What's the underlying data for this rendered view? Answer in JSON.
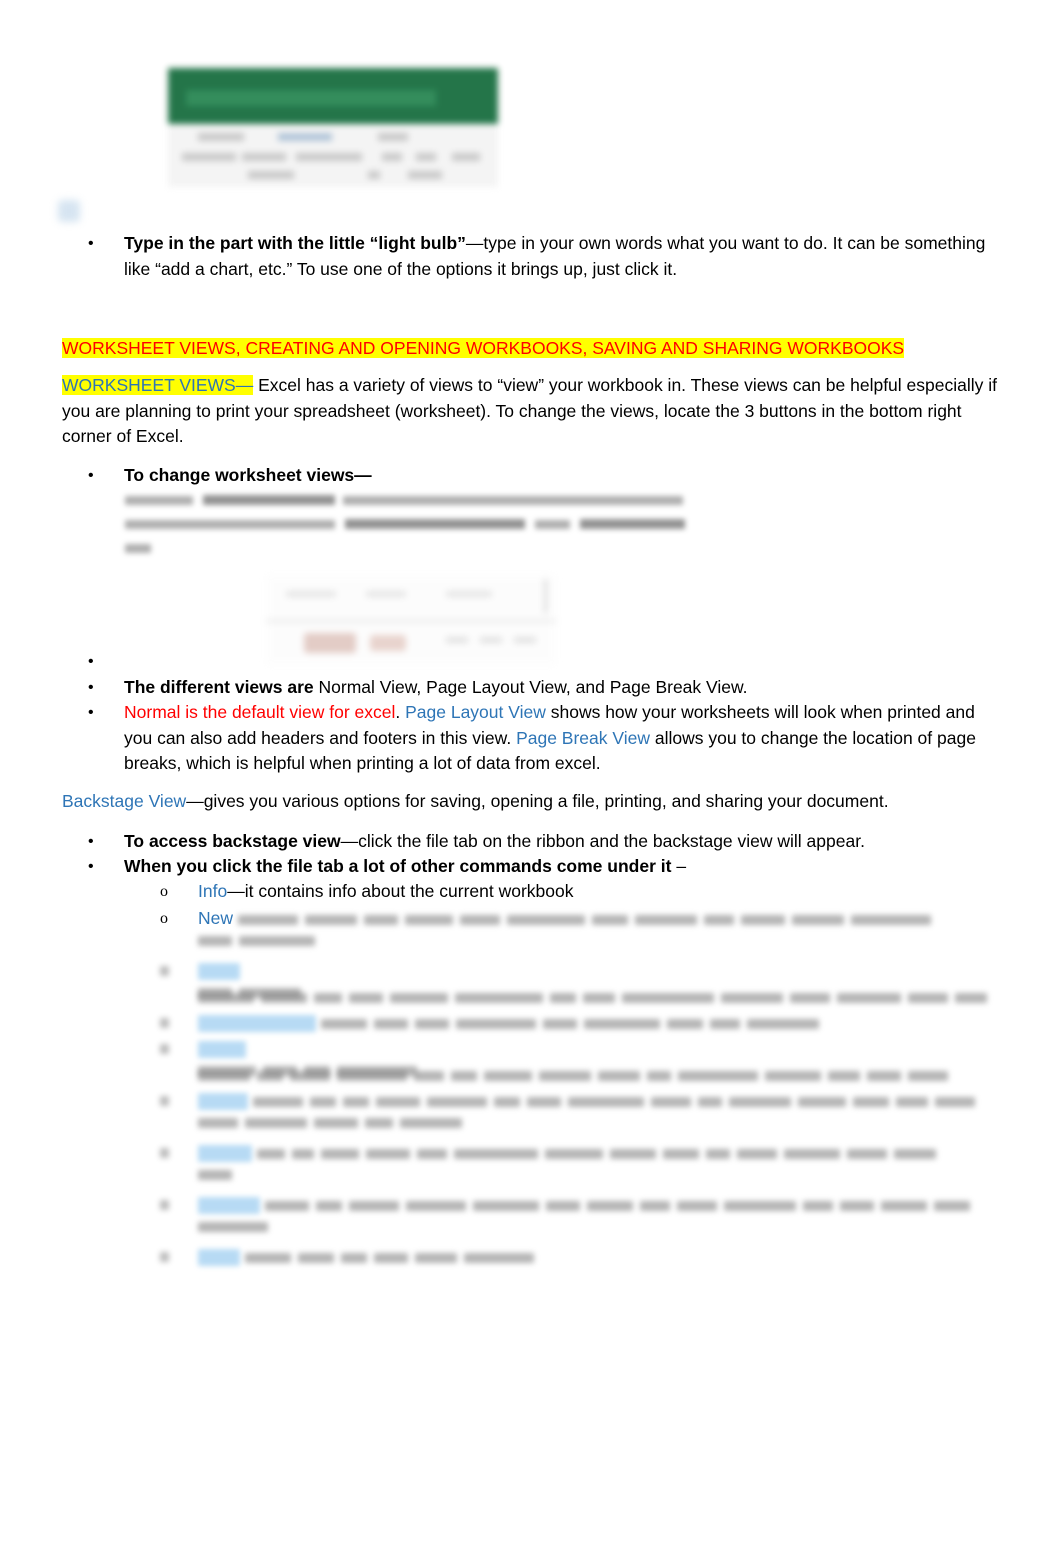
{
  "document": {
    "title": "Excel Notes - Worksheet Views and Backstage View",
    "colors": {
      "heading_red": "#ff0000",
      "link_blue": "#2e75b6",
      "highlight_yellow": "#ffff00",
      "body_black": "#000000",
      "excel_green": "#1d7144"
    }
  },
  "images": {
    "tell_me_screenshot": "excel-tell-me-lightbulb-screenshot",
    "worksheet_views_screenshot": "excel-worksheet-view-buttons-screenshot",
    "left_margin_artifact": "blurred-marker-artifact"
  },
  "intro_bullet": {
    "marker": "•",
    "bold_lead": "Type in the part with the little “light bulb”",
    "rest": "—type in your own words what you want to do.  It can be something like “add a chart, etc.” To use one of the options it brings up, just click it."
  },
  "section_heading": {
    "text": "WORKSHEET VIEWS, CREATING AND OPENING WORKBOOKS, SAVING AND SHARING WORKBOOKS"
  },
  "worksheet_views_para": {
    "label": "WORKSHEET VIEWS—",
    "body": " Excel has a variety of views to “view” your workbook in. These views can be helpful especially if you are planning to print your spreadsheet (worksheet).  To change the views, locate the 3 buttons in the bottom right corner of Excel."
  },
  "bullets": {
    "change_views": {
      "marker": "•",
      "bold_lead": "To change worksheet views—"
    },
    "empty": {
      "marker": "•",
      "text": ""
    },
    "different_views": {
      "marker": "•",
      "bold_lead": "The different views are",
      "rest": " Normal View, Page Layout View, and Page Break View."
    },
    "views_detail": {
      "marker": "•",
      "red_lead": "Normal is the default view for excel",
      "after_red": ".  ",
      "blue_1": "Page Layout View",
      "mid_1": " shows how your worksheets will look when printed and you can also add headers and footers in this view. ",
      "blue_2": " Page Break View",
      "mid_2": " allows you to change the location of page breaks, which is helpful when printing a lot of data from excel."
    }
  },
  "backstage_para": {
    "label": "Backstage View",
    "body": "—gives you various options for saving, opening a file, printing, and sharing your document."
  },
  "backstage_bullets": {
    "access": {
      "marker": "•",
      "bold_lead": "To access backstage view",
      "rest": "—click the file tab on the ribbon and the backstage view will appear."
    },
    "commands": {
      "marker": "•",
      "bold_lead": "When you click the file tab a lot of other commands come under it",
      "rest": " –"
    }
  },
  "sub_bullets": [
    {
      "marker": "o",
      "keyword": "Info",
      "description": "—it contains info about the current workbook",
      "blurred": false
    },
    {
      "marker": "o",
      "keyword": "New",
      "description": "",
      "blurred": true
    },
    {
      "marker": "o",
      "keyword": "",
      "description": "",
      "blurred": true
    },
    {
      "marker": "o",
      "keyword": "",
      "description": "",
      "blurred": true
    },
    {
      "marker": "o",
      "keyword": "",
      "description": "",
      "blurred": true
    },
    {
      "marker": "o",
      "keyword": "",
      "description": "",
      "blurred": true
    },
    {
      "marker": "o",
      "keyword": "",
      "description": "",
      "blurred": true
    },
    {
      "marker": "o",
      "keyword": "",
      "description": "",
      "blurred": true
    },
    {
      "marker": "o",
      "keyword": "",
      "description": "",
      "blurred": true
    }
  ]
}
